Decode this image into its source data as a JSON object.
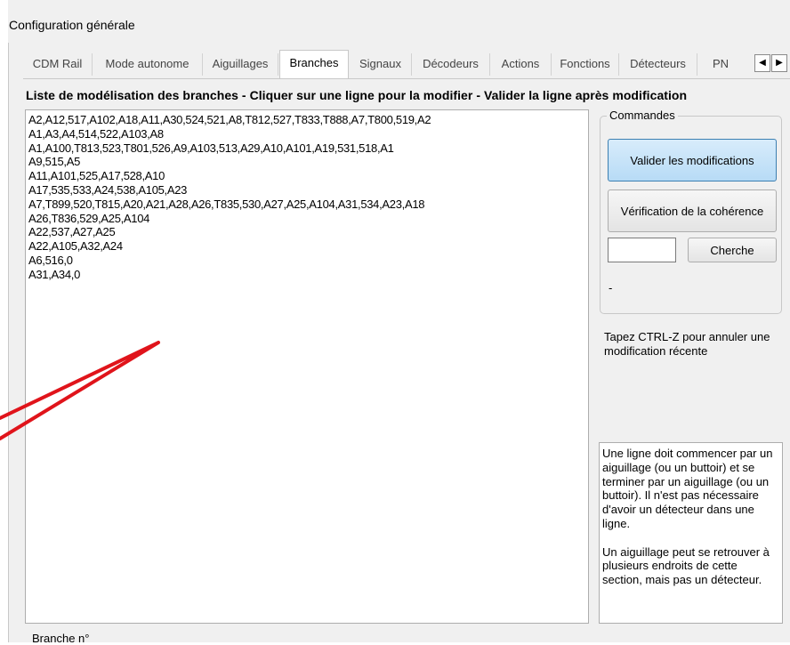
{
  "window": {
    "title": "Configuration générale"
  },
  "tabs": [
    {
      "label": "CDM Rail",
      "active": false
    },
    {
      "label": "Mode autonome",
      "active": false
    },
    {
      "label": "Aiguillages",
      "active": false
    },
    {
      "label": "Branches",
      "active": true
    },
    {
      "label": "Signaux",
      "active": false
    },
    {
      "label": "Décodeurs",
      "active": false
    },
    {
      "label": "Actions",
      "active": false
    },
    {
      "label": "Fonctions",
      "active": false
    },
    {
      "label": "Détecteurs",
      "active": false
    },
    {
      "label": "PN",
      "active": false
    }
  ],
  "tab_scroll": {
    "left_icon": "◀",
    "right_icon": "▶"
  },
  "branches_panel": {
    "heading": "Liste de modélisation des branches - Cliquer sur une ligne pour la modifier - Valider la ligne après modification",
    "lines": [
      "A2,A12,517,A102,A18,A11,A30,524,521,A8,T812,527,T833,T888,A7,T800,519,A2",
      "A1,A3,A4,514,522,A103,A8",
      "A1,A100,T813,523,T801,526,A9,A103,513,A29,A10,A101,A19,531,518,A1",
      "A9,515,A5",
      "A11,A101,525,A17,528,A10",
      "A17,535,533,A24,538,A105,A23",
      "A7,T899,520,T815,A20,A21,A28,A26,T835,530,A27,A25,A104,A31,534,A23,A18",
      "A26,T836,529,A25,A104",
      "A22,537,A27,A25",
      "A22,A105,A32,A24",
      "A6,516,0",
      "A31,A34,0"
    ]
  },
  "commands": {
    "group_label": "Commandes",
    "validate_button": "Valider les modifications",
    "check_button": "Vérification de la cohérence",
    "search_value": "",
    "search_button": "Cherche",
    "status_text": "-"
  },
  "undo_hint": "Tapez CTRL-Z pour annuler une modification récente",
  "rules": {
    "paragraph1": "Une ligne doit commencer par un aiguillage (ou un buttoir) et se terminer par un aiguillage (ou un buttoir). Il n'est pas nécessaire d'avoir un détecteur dans une ligne.",
    "paragraph2": "Un aiguillage peut se retrouver à plusieurs endroits de cette section, mais pas un détecteur."
  },
  "branch_number_label": "Branche n°",
  "colors": {
    "window_bg": "#f0f0f0",
    "primary_button": "#b7dbf6",
    "annotation_arrow": "#e0141b"
  }
}
